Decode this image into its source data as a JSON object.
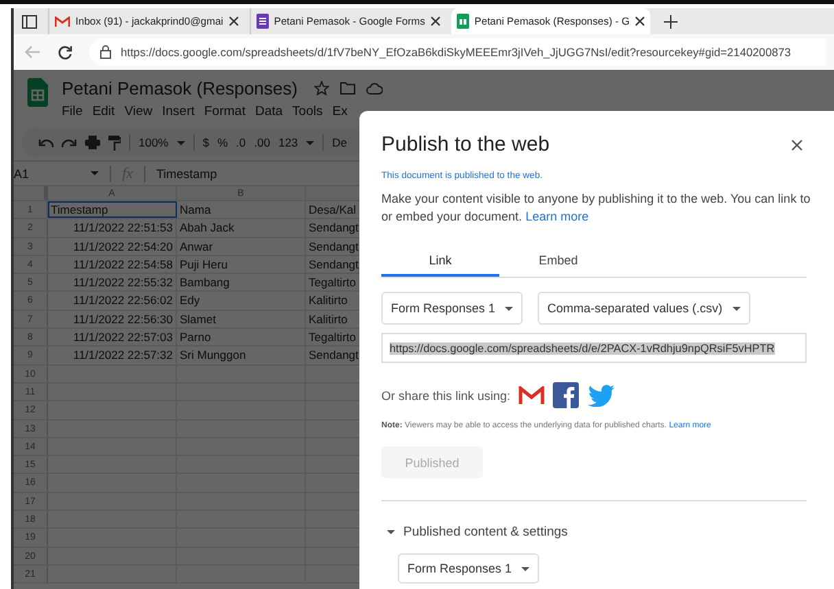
{
  "browser": {
    "tabs": [
      {
        "kind": "gmail",
        "title": "Inbox (91) - jackakprind0@gmai",
        "selected": false
      },
      {
        "kind": "forms",
        "title": "Petani Pemasok - Google Forms",
        "selected": false
      },
      {
        "kind": "sheets",
        "title": "Petani Pemasok (Responses) - G",
        "selected": true
      }
    ],
    "address": {
      "url": "https://docs.google.com/spreadsheets/d/1fV7beNY_EfOzaB6kdiSkyMEEEmr3jIVeh_JjUGG7NsI/edit?resourcekey#gid=2140200873"
    }
  },
  "sheet": {
    "title": "Petani Pemasok (Responses)",
    "menu": [
      "File",
      "Edit",
      "View",
      "Insert",
      "Format",
      "Data",
      "Tools",
      "Ex"
    ],
    "toolbar": {
      "zoom": "100%",
      "currency": "$",
      "percent": "%",
      "decrease_decimals": ".0",
      "increase_decimals": ".00",
      "number_format": "123",
      "font": "De"
    },
    "name_box": "A1",
    "function_label": "fx",
    "formula": "Timestamp",
    "columns": [
      "A",
      "B"
    ],
    "rows": [
      {
        "number": "1",
        "cells": [
          "Timestamp",
          "Nama",
          "Desa/Kal"
        ]
      },
      {
        "number": "2",
        "cells": [
          "11/1/2022 22:51:53",
          "Abah Jack",
          "Sendangt"
        ]
      },
      {
        "number": "3",
        "cells": [
          "11/1/2022 22:54:20",
          "Anwar",
          "Sendangt"
        ]
      },
      {
        "number": "4",
        "cells": [
          "11/1/2022 22:54:58",
          "Puji Heru",
          "Sendangt"
        ]
      },
      {
        "number": "5",
        "cells": [
          "11/1/2022 22:55:32",
          "Bambang",
          "Tegaltirto"
        ]
      },
      {
        "number": "6",
        "cells": [
          "11/1/2022 22:56:02",
          "Edy",
          "Kalitirto"
        ]
      },
      {
        "number": "7",
        "cells": [
          "11/1/2022 22:56:30",
          "Slamet",
          "Kalitirto"
        ]
      },
      {
        "number": "8",
        "cells": [
          "11/1/2022 22:57:03",
          "Parno",
          "Tegaltirto"
        ]
      },
      {
        "number": "9",
        "cells": [
          "11/1/2022 22:57:32",
          "Sri Munggon",
          "Sendangt"
        ]
      },
      {
        "number": "10",
        "cells": []
      },
      {
        "number": "11",
        "cells": []
      },
      {
        "number": "12",
        "cells": []
      },
      {
        "number": "13",
        "cells": []
      },
      {
        "number": "14",
        "cells": []
      },
      {
        "number": "15",
        "cells": []
      },
      {
        "number": "16",
        "cells": []
      },
      {
        "number": "17",
        "cells": []
      },
      {
        "number": "18",
        "cells": []
      },
      {
        "number": "19",
        "cells": []
      },
      {
        "number": "20",
        "cells": []
      },
      {
        "number": "21",
        "cells": []
      }
    ]
  },
  "dialog": {
    "title": "Publish to the web",
    "status": "This document is published to the web.",
    "description": "Make your content visible to anyone by publishing it to the web. You can link to or embed your document.",
    "description_link": "Learn more",
    "tabs": [
      {
        "label": "Link",
        "selected": true
      },
      {
        "label": "Embed",
        "selected": false
      }
    ],
    "sheet_select": "Form Responses 1",
    "format_select": "Comma-separated values (.csv)",
    "link_url": "https://docs.google.com/spreadsheets/d/e/2PACX-1vRdhju9npQRsiF5vHPTR",
    "share_label": "Or share this link using:",
    "share_targets": [
      {
        "kind": "gmail"
      },
      {
        "kind": "facebook"
      },
      {
        "kind": "twitter"
      }
    ],
    "note": "**Note:** Viewers may be able to access the underlying data for published charts.",
    "note_link": "Learn more",
    "publish_button": {
      "label": "Published",
      "disabled": true
    },
    "section": {
      "label": "Published content & settings",
      "expanded": true
    },
    "content_select": "Form Responses 1"
  }
}
